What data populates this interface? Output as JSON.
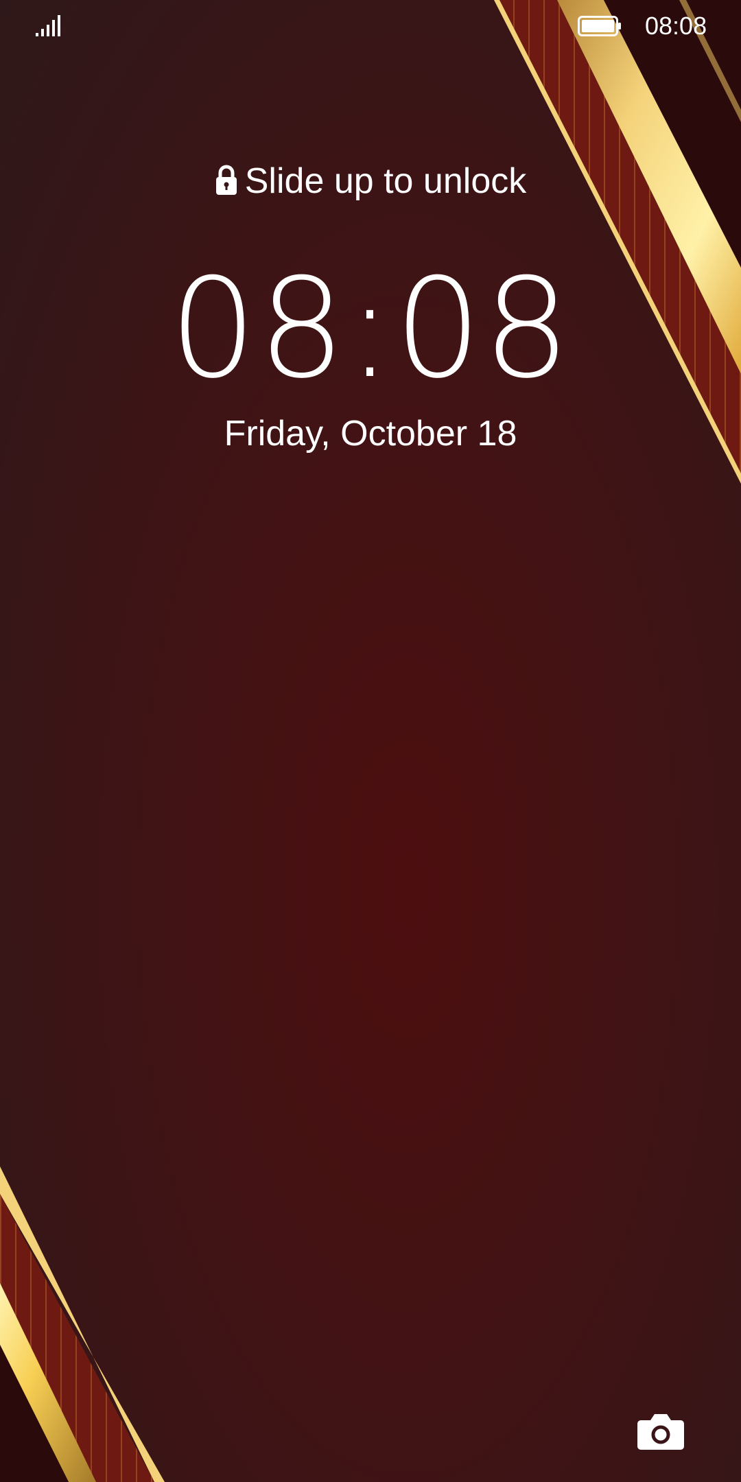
{
  "status_bar": {
    "time": "08:08",
    "signal_icon": "signal-bars-icon",
    "battery_icon": "battery-icon"
  },
  "lock_screen": {
    "hint": "Slide up to unlock",
    "lock_icon": "lock-icon",
    "clock": "08:08",
    "date": "Friday, October 18",
    "camera_icon": "camera-icon"
  },
  "colors": {
    "background": "#441213",
    "accent_gold": "#f2c75a",
    "text": "#ffffff"
  }
}
